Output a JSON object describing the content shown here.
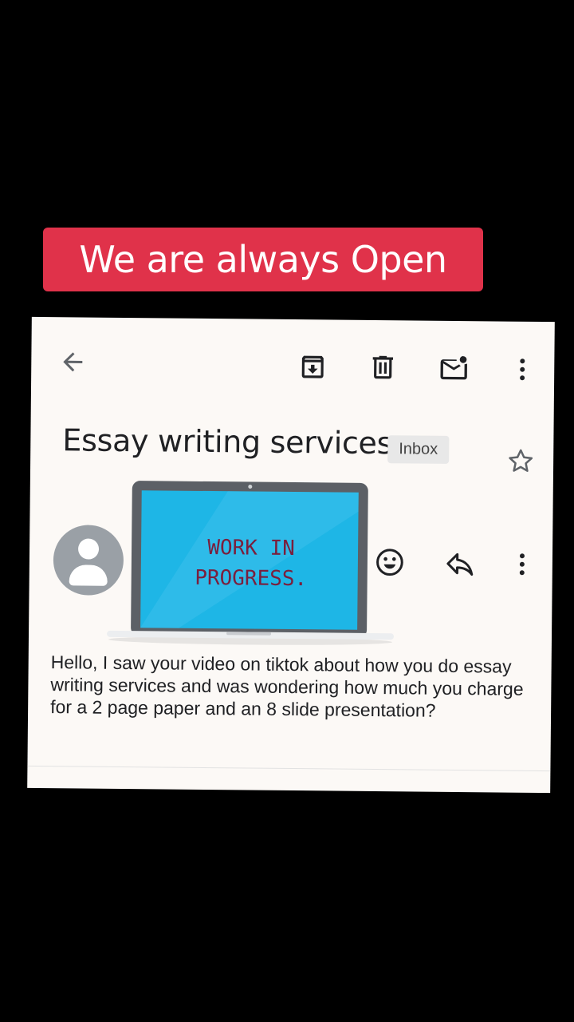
{
  "banner": {
    "text": "We are always Open"
  },
  "email": {
    "subject": "Essay writing services",
    "label": "Inbox",
    "body": "Hello, I saw your video on tiktok about how you do essay writing services and was wondering how much you charge for a 2 page paper and an 8 slide presentation?"
  },
  "overlay": {
    "line1": "WORK IN",
    "line2": "PROGRESS."
  },
  "icons": [
    "back-arrow-icon",
    "archive-icon",
    "delete-icon",
    "mark-unread-icon",
    "more-vert-icon",
    "star-icon",
    "emoji-icon",
    "reply-icon",
    "more-vert-icon"
  ],
  "colors": {
    "banner": "#e0324a",
    "screen": "#1eb6e6",
    "card": "#fcf9f6"
  }
}
